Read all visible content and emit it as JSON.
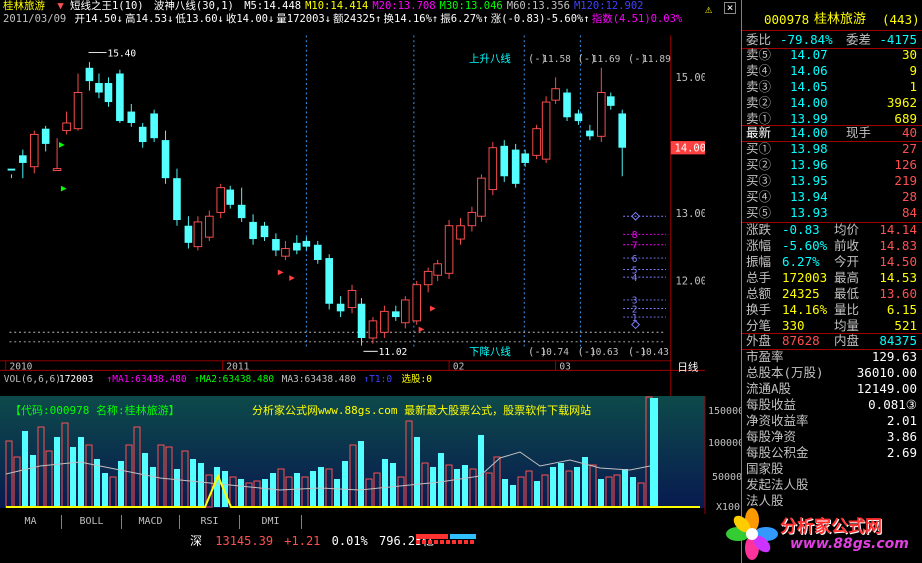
{
  "header": {
    "stock_name": "桂林旅游",
    "indicator1": "短线之王1(10)",
    "indicator2": "波神八线(30,1)",
    "ma_items": [
      {
        "label": "M5:14.448",
        "color": "#ffffff"
      },
      {
        "label": "M10:14.414",
        "color": "#ffff00"
      },
      {
        "label": "M20:13.708",
        "color": "#ff00ff"
      },
      {
        "label": "M30:13.046",
        "color": "#00ff00"
      },
      {
        "label": "M60:13.356",
        "color": "#c0c0c0"
      },
      {
        "label": "M120:12.902",
        "color": "#4040ff"
      }
    ],
    "ohlc_line": "2011/03/09 开14.50 ↓高14.53 ↓低13.60 ↓收14.00 ↓量172003 ↓额24325 ↑换14.16% ↑振6.27% ↑涨(-0.83)-5.60% ↑指数(4.51)0.03%",
    "ohlc_parts": [
      {
        "text": "2011/03/09",
        "color": "#c0c0c0"
      },
      {
        "text": " 开14.50↓",
        "color": "#ffffff"
      },
      {
        "text": "高14.53↓",
        "color": "#ffffff"
      },
      {
        "text": "低13.60↓",
        "color": "#ffffff"
      },
      {
        "text": "收14.00↓",
        "color": "#ffffff"
      },
      {
        "text": "量172003↓",
        "color": "#ffffff"
      },
      {
        "text": "额24325↑",
        "color": "#ffffff"
      },
      {
        "text": "换14.16%↑",
        "color": "#ffffff"
      },
      {
        "text": "振6.27%↑",
        "color": "#ffffff"
      },
      {
        "text": "涨(-0.83)-5.60%↑",
        "color": "#ffffff"
      },
      {
        "text": "指数(4.51)0.03%",
        "color": "#ff00ff"
      }
    ]
  },
  "chart": {
    "price_labels": [
      "15.00",
      "14.00",
      "13.00",
      "12.00"
    ],
    "current_price_tag": "14.00",
    "high_label": "15.40",
    "low_label": "11.02",
    "upper_line_label": "上升八线",
    "upper_values": [
      "11.58",
      "11.69",
      "11.89"
    ],
    "lower_line_label": "下降八线",
    "lower_values": [
      "10.74",
      "10.63",
      "10.43"
    ],
    "date_labels": [
      "2010",
      "2011",
      "02",
      "03"
    ],
    "period": "日线",
    "ladder": [
      "8",
      "7",
      "6",
      "5",
      "4",
      "3",
      "2",
      "1"
    ]
  },
  "volume": {
    "header_parts": [
      {
        "text": "VOL(6,6,6)",
        "color": "#c0c0c0"
      },
      {
        "text": "172003",
        "color": "#ffffff"
      },
      {
        "text": "↑MA1:63438.480",
        "color": "#ff00ff"
      },
      {
        "text": "↑MA2:63438.480",
        "color": "#00ff00"
      },
      {
        "text": "MA3:63438.480",
        "color": "#c0c0c0"
      },
      {
        "text": "↑T1:0",
        "color": "#4040ff"
      },
      {
        "text": "选股:0",
        "color": "#ffff00"
      }
    ],
    "banner_left": "【代码:000978 名称:桂林旅游】",
    "banner_right": "分析家公式网www.88gs.com 最新最大股票公式，股票软件下载网站",
    "axis_labels": [
      "150000",
      "100000",
      "50000",
      "X100"
    ]
  },
  "tabs": [
    "MA",
    "BOLL",
    "MACD",
    "RSI",
    "DMI"
  ],
  "status": {
    "market": "深",
    "index": "13145.39",
    "change": "+1.21",
    "pct": "0.01%",
    "amount": "796.25亿"
  },
  "panel": {
    "code": "000978",
    "name": "桂林旅游",
    "rank": "(443)",
    "weibi_label": "委比",
    "weibi": "-79.84%",
    "weicha_label": "委差",
    "weicha": "-4175",
    "asks": [
      {
        "label": "卖⑤",
        "price": "14.07",
        "vol": "30"
      },
      {
        "label": "卖④",
        "price": "14.06",
        "vol": "9"
      },
      {
        "label": "卖③",
        "price": "14.05",
        "vol": "1"
      },
      {
        "label": "卖②",
        "price": "14.00",
        "vol": "3962"
      },
      {
        "label": "卖①",
        "price": "13.99",
        "vol": "689"
      }
    ],
    "latest_label": "最新",
    "latest": "14.00",
    "xianshou_label": "现手",
    "xianshou": "40",
    "bids": [
      {
        "label": "买①",
        "price": "13.98",
        "vol": "27"
      },
      {
        "label": "买②",
        "price": "13.96",
        "vol": "126"
      },
      {
        "label": "买③",
        "price": "13.95",
        "vol": "219"
      },
      {
        "label": "买④",
        "price": "13.94",
        "vol": "28"
      },
      {
        "label": "买⑤",
        "price": "13.93",
        "vol": "84"
      }
    ],
    "stats": [
      {
        "l1": "涨跌",
        "v1": "-0.83",
        "l2": "均价",
        "v2": "14.14"
      },
      {
        "l1": "涨幅",
        "v1": "-5.60%",
        "l2": "前收",
        "v2": "14.83"
      },
      {
        "l1": "振幅",
        "v1": "6.27%",
        "l2": "今开",
        "v2": "14.50"
      },
      {
        "l1": "总手",
        "v1": "172003",
        "l2": "最高",
        "v2": "14.53"
      },
      {
        "l1": "总额",
        "v1": "24325",
        "l2": "最低",
        "v2": "13.60"
      },
      {
        "l1": "换手",
        "v1": "14.16%",
        "l2": "量比",
        "v2": "6.15"
      },
      {
        "l1": "分笔",
        "v1": "330",
        "l2": "均量",
        "v2": "521"
      }
    ],
    "waipan_label": "外盘",
    "waipan": "87628",
    "neipan_label": "内盘",
    "neipan": "84375",
    "finance": [
      {
        "label": "市盈率",
        "value": "129.63"
      },
      {
        "label": "总股本(万股)",
        "value": "36010.00"
      },
      {
        "label": "流通A股",
        "value": "12149.00"
      },
      {
        "label": "每股收益",
        "value": "0.081③"
      },
      {
        "label": "净资收益率",
        "value": "2.01"
      },
      {
        "label": "每股净资",
        "value": "3.86"
      },
      {
        "label": "每股公积金",
        "value": "2.69"
      },
      {
        "label": "国家股",
        "value": ""
      },
      {
        "label": "发起法人股",
        "value": ""
      },
      {
        "label": "法人股",
        "value": ""
      }
    ],
    "logo_text": "分析家公式网",
    "logo_url": "www.88gs.com"
  }
}
